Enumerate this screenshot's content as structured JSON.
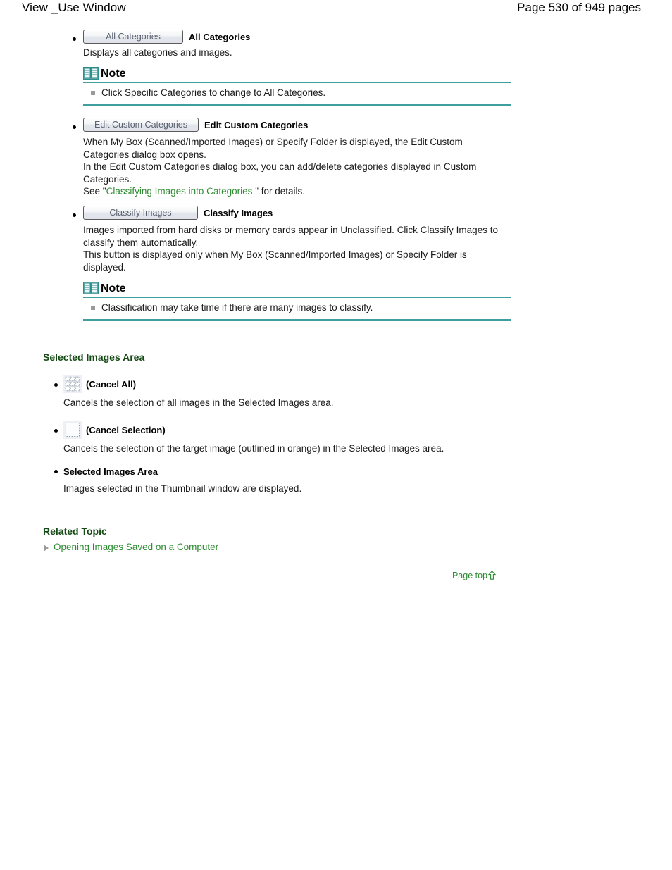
{
  "header": {
    "title": "View _Use Window",
    "page_info": "Page 530 of 949 pages"
  },
  "items": [
    {
      "button_label": "All Categories",
      "name_label": "All Categories",
      "description": "Displays all categories and images.",
      "note": {
        "title": "Note",
        "text": "Click Specific Categories to change to All Categories."
      }
    },
    {
      "button_label": "Edit Custom Categories",
      "name_label": "Edit Custom Categories",
      "description_line1": "When My Box (Scanned/Imported Images) or Specify Folder is displayed, the Edit Custom Categories dialog box opens.",
      "description_line2": "In the Edit Custom Categories dialog box, you can add/delete categories displayed in Custom Categories.",
      "see_prefix": "See \"",
      "see_link": "Classifying Images into Categories",
      "see_suffix": " \" for details."
    },
    {
      "button_label": "Classify Images",
      "name_label": "Classify Images",
      "description_line1": "Images imported from hard disks or memory cards appear in Unclassified. Click Classify Images to classify them automatically.",
      "description_line2": "This button is displayed only when My Box (Scanned/Imported Images) or Specify Folder is displayed.",
      "note": {
        "title": "Note",
        "text": "Classification may take time if there are many images to classify."
      }
    }
  ],
  "selected_images_area": {
    "heading": "Selected Images Area",
    "entries": [
      {
        "icon": "cancel-all-icon",
        "label": "(Cancel All)",
        "description": "Cancels the selection of all images in the Selected Images area."
      },
      {
        "icon": "cancel-selection-icon",
        "label": "(Cancel Selection)",
        "description": "Cancels the selection of the target image (outlined in orange) in the Selected Images area."
      }
    ],
    "plain_entry": {
      "label": "Selected Images Area",
      "description": "Images selected in the Thumbnail window are displayed."
    }
  },
  "related_topic": {
    "heading": "Related Topic",
    "link": "Opening Images Saved on a Computer"
  },
  "page_top": {
    "label": "Page top",
    "arrow": "up-arrow-icon"
  },
  "colors": {
    "link_green": "#2e8b32",
    "heading_green": "#154a15",
    "note_rule_teal": "#3f9e9e",
    "note_bullet_grey": "#9a9a9a",
    "button_text": "#5a6270"
  }
}
